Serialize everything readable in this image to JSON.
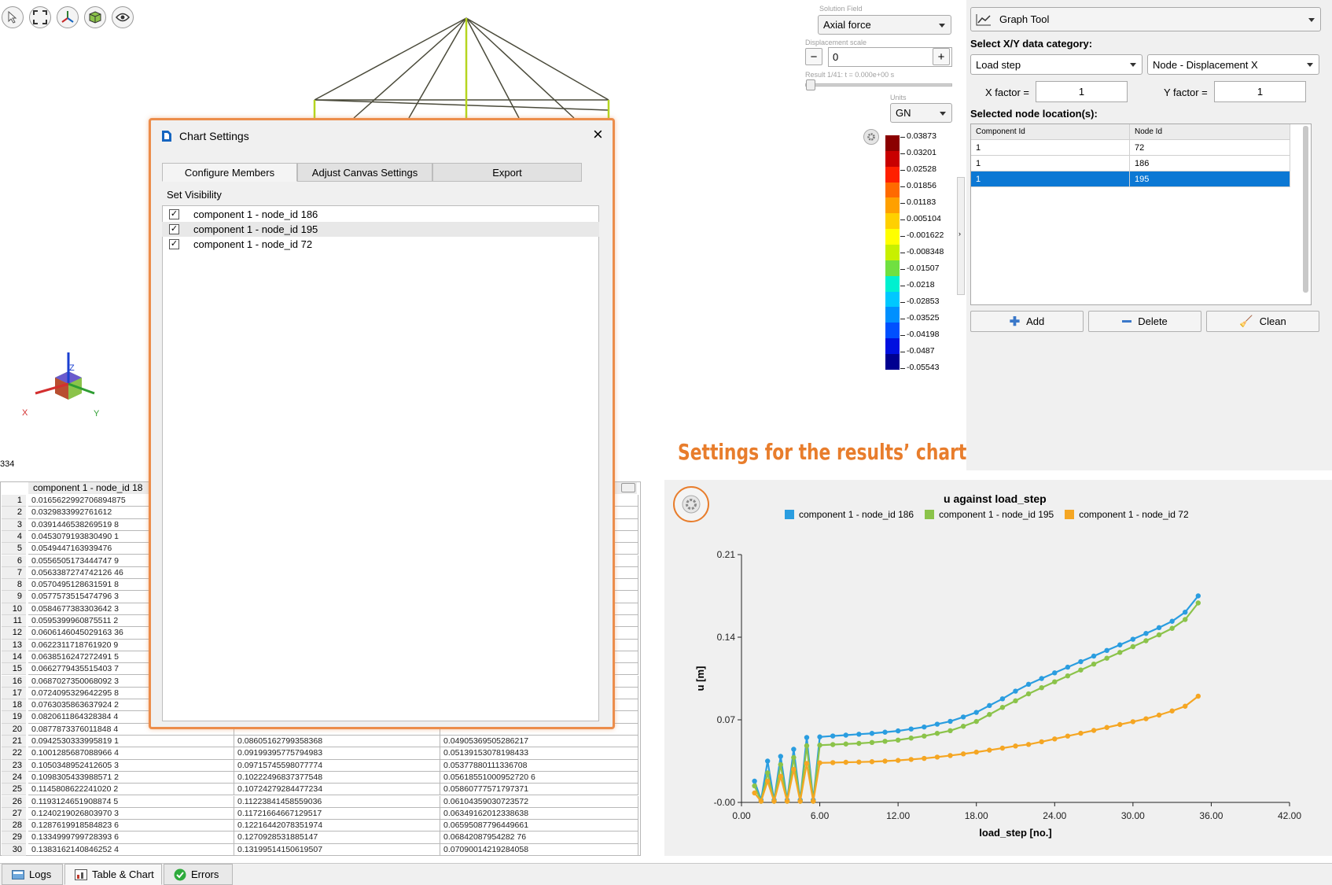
{
  "viewport": {
    "tool_icons": [
      "select-icon",
      "fit-view-icon",
      "axes-icon",
      "view-cube-icon",
      "visibility-eye-icon"
    ],
    "axis_labels": {
      "x": "X",
      "y": "Y",
      "z": "Z"
    },
    "status_value": "334"
  },
  "solution_panel": {
    "field_label": "Solution Field",
    "field_value": "Axial force",
    "disp_label": "Displacement scale",
    "disp_value": "0",
    "minus_label": "−",
    "plus_label": "+",
    "result_label": "Result 1/41: t = 0.000e+00 s",
    "units_label": "Units",
    "units_value": "GN"
  },
  "legend": {
    "values": [
      "0.03873",
      "0.03201",
      "0.02528",
      "0.01856",
      "0.01183",
      "0.005104",
      "-0.001622",
      "-0.008348",
      "-0.01507",
      "-0.0218",
      "-0.02853",
      "-0.03525",
      "-0.04198",
      "-0.0487",
      "-0.05543"
    ],
    "colors": [
      "#8b0000",
      "#c80000",
      "#ff2000",
      "#ff6a00",
      "#ffa000",
      "#ffd000",
      "#ffff00",
      "#c8f000",
      "#70e040",
      "#00f0d0",
      "#00c8ff",
      "#0090ff",
      "#0050ff",
      "#0010e0",
      "#000090"
    ]
  },
  "graph_tool": {
    "title": "Graph Tool",
    "xy_label": "Select X/Y data category:",
    "x_category": "Load step",
    "y_category": "Node - Displacement X",
    "x_factor_label": "X factor =",
    "x_factor_value": "1",
    "y_factor_label": "Y factor =",
    "y_factor_value": "1",
    "nodes_label": "Selected node location(s):",
    "table_headers": [
      "Component Id",
      "Node Id"
    ],
    "table_rows": [
      [
        "1",
        "72"
      ],
      [
        "1",
        "186"
      ],
      [
        "1",
        "195"
      ]
    ],
    "add_label": "Add",
    "delete_label": "Delete",
    "clean_label": "Clean"
  },
  "annotation": {
    "text": "Settings for the results’ chart",
    "color": "#e87d2c"
  },
  "data_table": {
    "header": "component 1 - node_id 18",
    "row_numbers": [
      "1",
      "2",
      "3",
      "4",
      "5",
      "6",
      "7",
      "8",
      "9",
      "10",
      "11",
      "12",
      "13",
      "14",
      "15",
      "16",
      "17",
      "18",
      "19",
      "20",
      "21",
      "22",
      "23",
      "24",
      "25",
      "26",
      "27",
      "28",
      "29",
      "30"
    ],
    "col1": [
      "0.0165622992706894875",
      "0.0329833992761612",
      "0.0391446538269519 8",
      "0.0453079193830490 1",
      "0.0549447163939476",
      "0.0556505173444747 9",
      "0.0563387274742126 46",
      "0.0570495128631591 8",
      "0.0577573515474796 3",
      "0.0584677383303642 3",
      "0.0595399960875511 2",
      "0.0606146045029163 36",
      "0.0622311718761920 9",
      "0.0638516247272491 5",
      "0.0662779435515403 7",
      "0.0687027350068092 3",
      "0.0724095329642295 8",
      "0.0763035863637924 2",
      "0.0820611864328384 4",
      "0.0877873376011848 4",
      "0.0942530333995819 1",
      "0.1001285687088966 4",
      "0.1050348952412605 3",
      "0.1098305433988571 2",
      "0.1145808622241020 2",
      "0.1193124651908874 5",
      "0.1240219026803970 3",
      "0.1287619918584823 6",
      "0.1334999799728393 6",
      "0.1383162140846252 4"
    ],
    "col2": [
      "",
      "",
      "",
      "",
      "",
      "",
      "",
      "",
      "",
      "",
      "",
      "",
      "",
      "",
      "",
      "",
      "",
      "",
      "",
      "",
      "0.08605162799358368",
      "0.09199395775794983",
      "0.09715745598077774",
      "0.10222496837377548",
      "0.10724279284477234",
      "0.11223841458559036",
      "0.11721664667129517",
      "0.12216442078351974",
      "0.1270928531885147",
      "0.13199514150619507"
    ],
    "col3": [
      "",
      "",
      "",
      "",
      "",
      "",
      "",
      "",
      "",
      "",
      "",
      "",
      "",
      "",
      "",
      "",
      "",
      "",
      "",
      "",
      "0.04905369505286217",
      "0.05139153078198433",
      "0.05377880111336708",
      "0.05618551000952720 6",
      "0.05860777571797371",
      "0.06104359030723572",
      "0.06349162012338638",
      "0.06595087796449661",
      "0.06842087954282 76",
      "0.07090014219284058"
    ]
  },
  "dialog": {
    "title": "Chart Settings",
    "tabs": [
      "Configure Members",
      "Adjust Canvas Settings",
      "Export"
    ],
    "section": "Set Visibility",
    "check_mark": "✓",
    "members": [
      "component 1 - node_id 186",
      "component 1 - node_id 195",
      "component 1 - node_id 72"
    ],
    "close_icon": "close-icon"
  },
  "bottom_tabs": [
    {
      "label": "Logs",
      "icon": "logs-icon"
    },
    {
      "label": "Table & Chart",
      "icon": "table-chart-icon"
    },
    {
      "label": "Errors",
      "icon": "check-circle-icon"
    }
  ],
  "chart_data": {
    "type": "line",
    "title": "u against load_step",
    "xlabel": "load_step [no.]",
    "ylabel": "u [m]",
    "xlim": [
      0,
      42
    ],
    "ylim": [
      0,
      0.21
    ],
    "xticks": [
      "0.00",
      "6.00",
      "12.00",
      "18.00",
      "24.00",
      "30.00",
      "36.00",
      "42.00"
    ],
    "yticks": [
      "-0.00",
      "0.07",
      "0.14",
      "0.21"
    ],
    "legend_position": "top",
    "grid": false,
    "series": [
      {
        "name": "component 1 - node_id 186",
        "color": "#2a9de0",
        "x": [
          1,
          1.5,
          2,
          2.5,
          3,
          3.5,
          4,
          4.5,
          5,
          5.5,
          6,
          7,
          8,
          9,
          10,
          11,
          12,
          13,
          14,
          15,
          16,
          17,
          18,
          19,
          20,
          21,
          22,
          23,
          24,
          25,
          26,
          27,
          28,
          29,
          30,
          31,
          32,
          33,
          34,
          35
        ],
        "y": [
          0.018,
          0.002,
          0.035,
          0.002,
          0.039,
          0.002,
          0.045,
          0.002,
          0.055,
          0.002,
          0.0555,
          0.0563,
          0.057,
          0.0578,
          0.0585,
          0.0595,
          0.0606,
          0.0622,
          0.0639,
          0.0663,
          0.0687,
          0.0724,
          0.0763,
          0.0821,
          0.0878,
          0.0943,
          0.1001,
          0.105,
          0.1098,
          0.1146,
          0.1193,
          0.124,
          0.1288,
          0.1335,
          0.1383,
          0.1432,
          0.1481,
          0.1535,
          0.1612,
          0.175
        ]
      },
      {
        "name": "component 1 - node_id 195",
        "color": "#8bc34a",
        "x": [
          1,
          1.5,
          2,
          2.5,
          3,
          3.5,
          4,
          4.5,
          5,
          5.5,
          6,
          7,
          8,
          9,
          10,
          11,
          12,
          13,
          14,
          15,
          16,
          17,
          18,
          19,
          20,
          21,
          22,
          23,
          24,
          25,
          26,
          27,
          28,
          29,
          30,
          31,
          32,
          33,
          34,
          35
        ],
        "y": [
          0.014,
          0.001,
          0.025,
          0.001,
          0.032,
          0.001,
          0.038,
          0.001,
          0.048,
          0.001,
          0.0485,
          0.049,
          0.0495,
          0.05,
          0.0508,
          0.0518,
          0.0528,
          0.0545,
          0.0562,
          0.0585,
          0.0608,
          0.0645,
          0.0686,
          0.0745,
          0.0805,
          0.0861,
          0.092,
          0.0972,
          0.1022,
          0.1072,
          0.1122,
          0.1172,
          0.1222,
          0.1271,
          0.132,
          0.137,
          0.142,
          0.1475,
          0.155,
          0.169
        ]
      },
      {
        "name": "component 1 - node_id 72",
        "color": "#f5a623",
        "x": [
          1,
          1.5,
          2,
          2.5,
          3,
          3.5,
          4,
          4.5,
          5,
          5.5,
          6,
          7,
          8,
          9,
          10,
          11,
          12,
          13,
          14,
          15,
          16,
          17,
          18,
          19,
          20,
          21,
          22,
          23,
          24,
          25,
          26,
          27,
          28,
          29,
          30,
          31,
          32,
          33,
          34,
          35
        ],
        "y": [
          0.008,
          0.001,
          0.018,
          0.001,
          0.022,
          0.001,
          0.028,
          0.001,
          0.033,
          0.001,
          0.0335,
          0.0337,
          0.034,
          0.0342,
          0.0345,
          0.035,
          0.0356,
          0.0364,
          0.0373,
          0.0384,
          0.0397,
          0.0411,
          0.0426,
          0.0443,
          0.046,
          0.0478,
          0.0491,
          0.0514,
          0.0538,
          0.0562,
          0.0586,
          0.061,
          0.0635,
          0.066,
          0.0684,
          0.0709,
          0.074,
          0.0775,
          0.0815,
          0.09
        ]
      }
    ]
  }
}
